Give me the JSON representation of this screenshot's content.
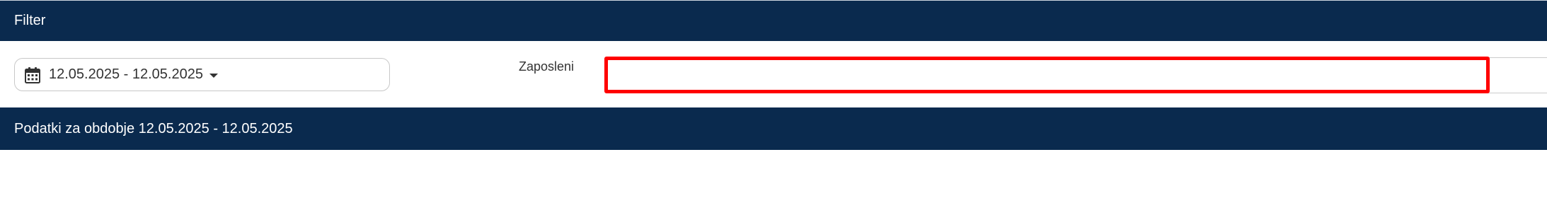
{
  "filter_panel": {
    "title": "Filter",
    "date_range": {
      "value": "12.05.2025 - 12.05.2025",
      "icon": "calendar-icon"
    },
    "employees": {
      "label": "Zaposleni",
      "value": "",
      "placeholder": ""
    }
  },
  "data_panel": {
    "title": "Podatki za obdobje 12.05.2025 - 12.05.2025"
  },
  "colors": {
    "header_bg": "#0a2a4e",
    "header_text": "#ffffff",
    "highlight": "#ff0000"
  }
}
